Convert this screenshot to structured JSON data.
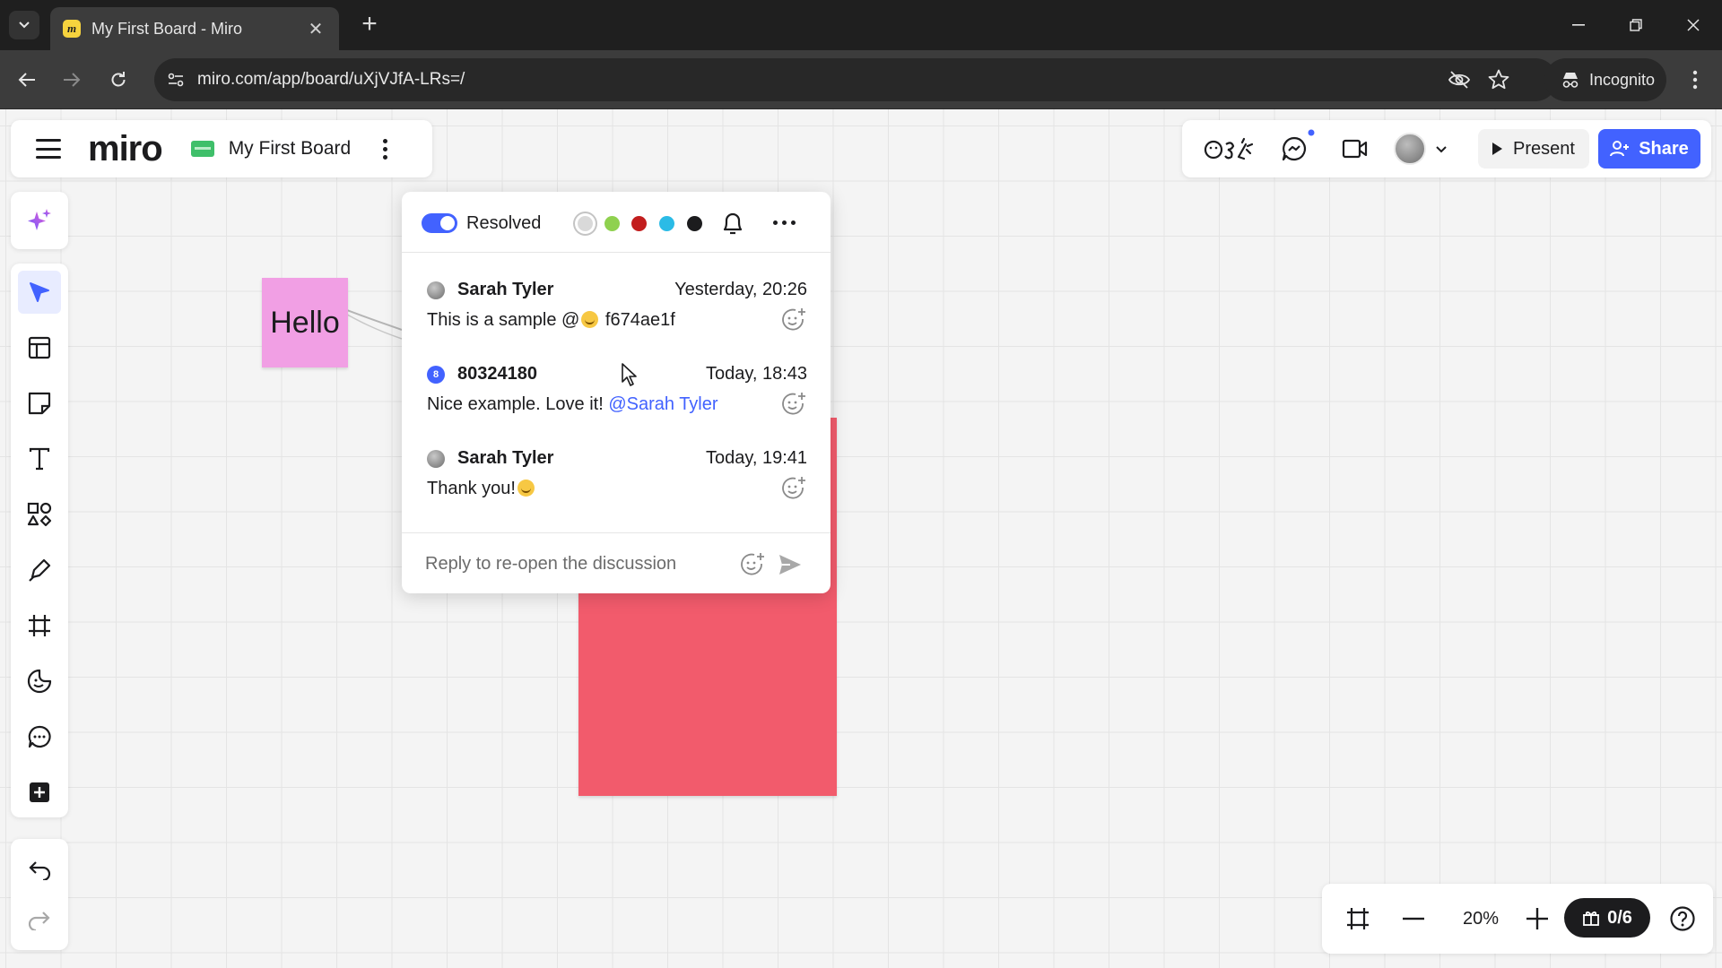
{
  "browser": {
    "tab_title": "My First Board - Miro",
    "tab_favicon": "miro-favicon-icon",
    "url": "miro.com/app/board/uXjVJfA-LRs=/",
    "incognito_label": "Incognito"
  },
  "board": {
    "app_logo": "miro",
    "name": "My First Board"
  },
  "header_actions": {
    "present_label": "Present",
    "share_label": "Share",
    "accent_color": "#4262ff"
  },
  "canvas": {
    "sticky_hello_text": "Hello",
    "sticky_hello_color": "#f19fe4",
    "sticky_red_color": "#f25b6c"
  },
  "comment_thread": {
    "resolved_label": "Resolved",
    "resolved_on": true,
    "color_options": [
      "#d9d9d9",
      "#8fd14f",
      "#c21e1e",
      "#2bbbe6",
      "#1c1c1e"
    ],
    "selected_color": "#d9d9d9",
    "messages": [
      {
        "author": "Sarah Tyler",
        "time": "Yesterday, 20:26",
        "text_before": "This is a sample @",
        "text_after": " f674ae1f"
      },
      {
        "author": "80324180",
        "avatar_letter": "8",
        "time": "Today, 18:43",
        "text_before": "Nice example. Love it! ",
        "mention": "@Sarah Tyler"
      },
      {
        "author": "Sarah Tyler",
        "time": "Today, 19:41",
        "text_before": "Thank you!"
      }
    ],
    "reply_placeholder": "Reply to re-open the discussion"
  },
  "zoom": {
    "level": "20%",
    "boards_counter": "0/6"
  }
}
